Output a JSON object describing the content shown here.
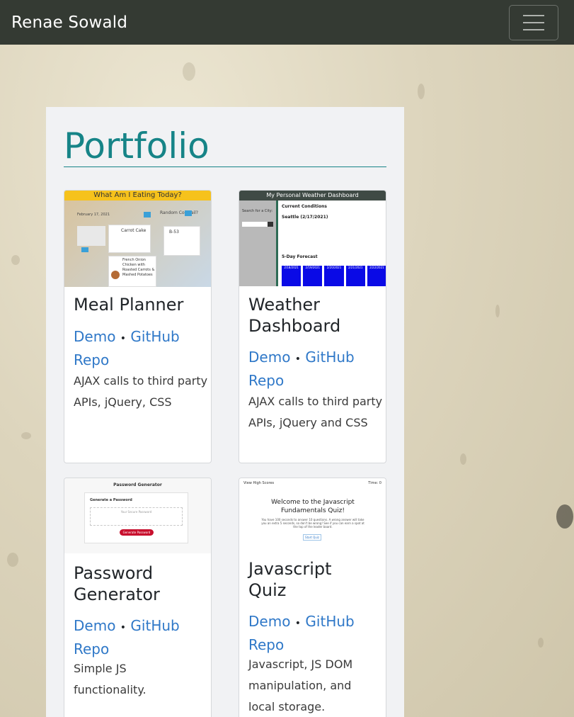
{
  "nav": {
    "brand": "Renae Sowald"
  },
  "page": {
    "title": "Portfolio"
  },
  "projects": [
    {
      "title": "Meal Planner",
      "demo": "Demo",
      "sep": "•",
      "repo": "GitHub Repo",
      "desc": "AJAX calls to third party APIs, jQuery, CSS",
      "thumb": {
        "header": "What Am I Eating Today?",
        "date": "February 17, 2021",
        "random": "Random Cocktail?",
        "item1": "Carrot Cake",
        "item2": "B-53",
        "item3": "French Onion Chicken with Roasted Carrots & Mashed Potatoes"
      }
    },
    {
      "title": "Weather Dashboard",
      "demo": "Demo",
      "sep": "•",
      "repo": "GitHub Repo",
      "desc": "AJAX calls to third party APIs, jQuery and CSS",
      "thumb": {
        "header": "My Personal Weather Dashboard",
        "search": "Search for a City:",
        "current": "Current Conditions",
        "city": "Seattle (2/17/2021)",
        "forecast": "5-Day Forecast",
        "days": [
          "2/18/2021",
          "2/19/2021",
          "2/20/2021",
          "2/21/2021",
          "2/22/2021"
        ]
      }
    },
    {
      "title": "Password Generator",
      "demo": "Demo",
      "sep": "•",
      "repo": "GitHub Repo",
      "desc": "Simple JS functionality.",
      "thumb": {
        "header": "Password Generator",
        "sub": "Generate a Password",
        "placeholder": "Your Secure Password",
        "button": "Generate Password"
      }
    },
    {
      "title": "Javascript Quiz",
      "demo": "Demo",
      "sep": "•",
      "repo": "GitHub Repo",
      "desc": "Javascript, JS DOM manipulation, and local storage.",
      "thumb": {
        "left": "View High Scores",
        "right": "Time: 0",
        "heading": "Welcome to the Javascript Fundamentals Quiz!",
        "body": "You have 100 seconds to answer 10 questions. A wrong answer will take you an extra 5 seconds, so don't be wrong! See if you can earn a spot at the top of the leader board.",
        "start": "Start Quiz"
      }
    }
  ],
  "colors": {
    "accent": "#168487",
    "link": "#2f78c8",
    "navbar": "#343a33"
  }
}
